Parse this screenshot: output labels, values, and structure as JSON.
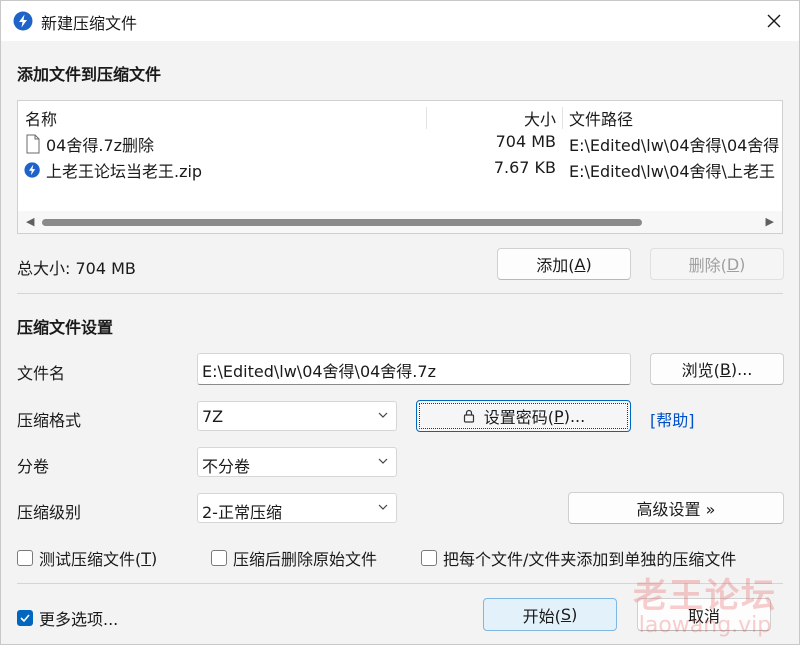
{
  "window": {
    "title": "新建压缩文件",
    "close_icon": "close-icon",
    "app_icon": "bandizip-icon"
  },
  "add_section": {
    "title": "添加文件到压缩文件",
    "columns": [
      "名称",
      "大小",
      "文件路径"
    ],
    "files": [
      {
        "name": "04舍得.7z删除",
        "size": "704 MB",
        "path": "E:\\Edited\\lw\\04舍得\\04舍得",
        "icon": "file-icon"
      },
      {
        "name": "上老王论坛当老王.zip",
        "size": "7.67 KB",
        "path": "E:\\Edited\\lw\\04舍得\\上老王",
        "icon": "bandizip-icon"
      }
    ],
    "total_size": "总大小: 704 MB",
    "add_button": "添加(",
    "add_key": "A",
    "delete_button": "删除(",
    "delete_key": "D"
  },
  "settings": {
    "title": "压缩文件设置",
    "filename_label": "文件名",
    "filename_value": "E:\\Edited\\lw\\04舍得\\04舍得.7z",
    "browse_button": "浏览(",
    "browse_key": "B",
    "format_label": "压缩格式",
    "format_value": "7Z",
    "password_button": "设置密码(",
    "password_key": "P",
    "help_link": "[帮助]",
    "split_label": "分卷",
    "split_value": "不分卷",
    "level_label": "压缩级别",
    "level_value": "2-正常压缩",
    "advanced_button": "高级设置 »",
    "checkboxes": [
      {
        "label": "测试压缩文件(",
        "key": "T",
        "checked": false
      },
      {
        "label": "压缩后删除原始文件",
        "checked": false
      },
      {
        "label": "把每个文件/文件夹添加到单独的压缩文件",
        "checked": false
      }
    ]
  },
  "footer": {
    "more_options": "更多选项...",
    "more_options_checked": true,
    "start_button": "开始(",
    "start_key": "S",
    "cancel_button": "取消"
  },
  "watermark": {
    "line1": "老王论坛",
    "line2": "laowang.vip"
  },
  "colors": {
    "accent": "#0067c0",
    "link": "#0050c8",
    "primary_button_bg": "#e3f1fb"
  }
}
